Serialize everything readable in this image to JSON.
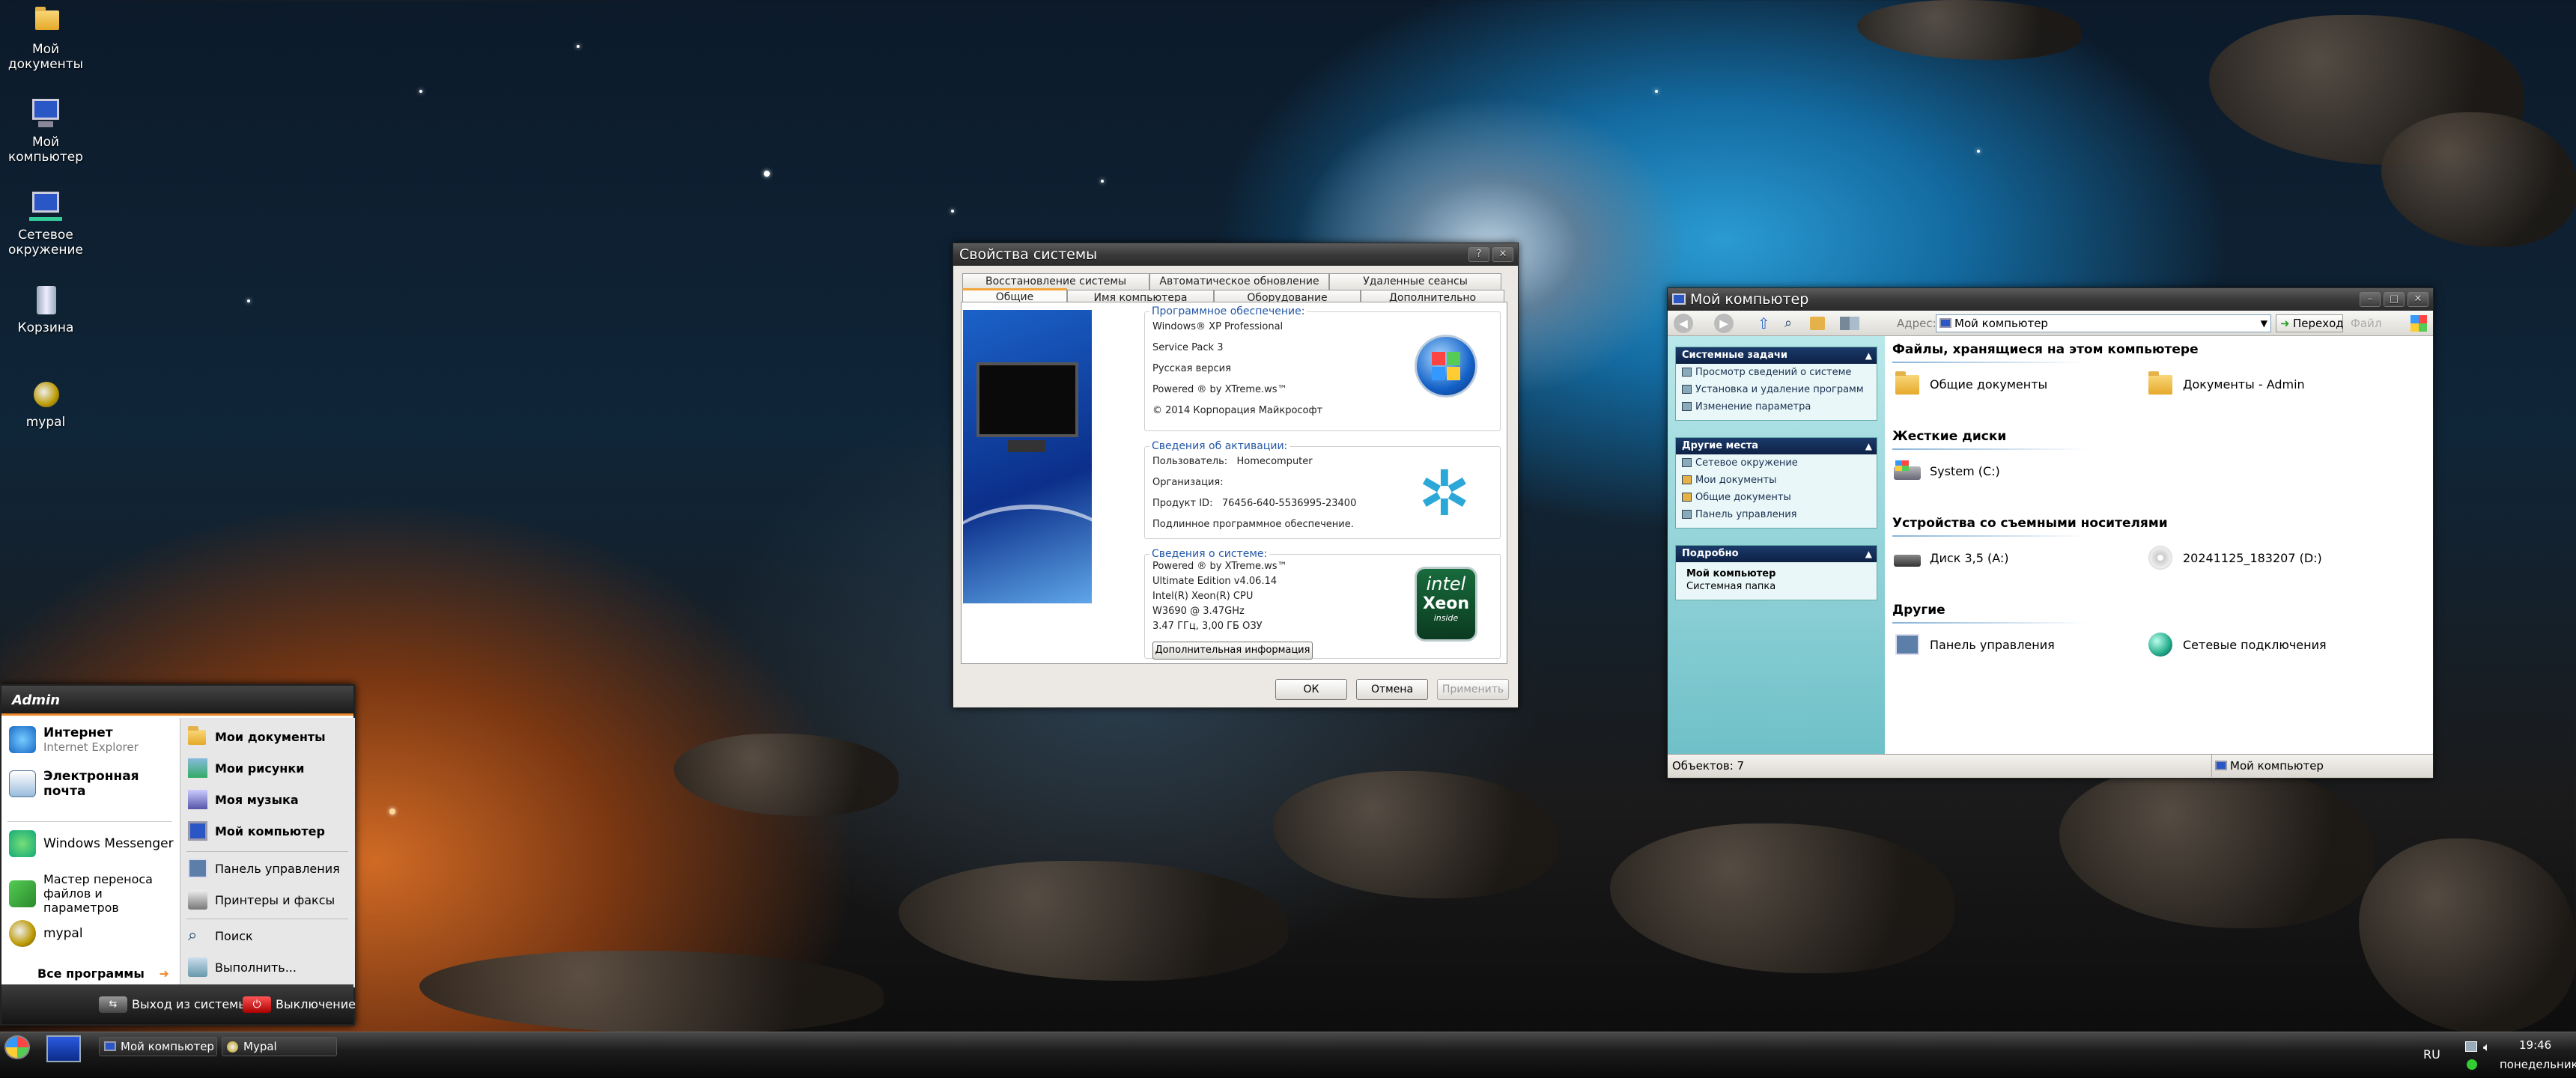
{
  "desktop": {
    "icons": [
      {
        "label": "Мой документы",
        "icon": "folder-documents-icon"
      },
      {
        "label": "Мой компьютер",
        "icon": "computer-icon"
      },
      {
        "label": "Сетевое окружение",
        "icon": "network-icon"
      },
      {
        "label": "Корзина",
        "icon": "recycle-bin-icon"
      },
      {
        "label": "mypal",
        "icon": "mypal-icon"
      }
    ]
  },
  "sysprops": {
    "title": "Свойства системы",
    "tabs_back": [
      "Восстановление системы",
      "Автоматическое обновление",
      "Удаленные сеансы"
    ],
    "tabs_front": [
      "Общие",
      "Имя компьютера",
      "Оборудование",
      "Дополнительно"
    ],
    "software": {
      "heading": "Программное обеспечение:",
      "lines": [
        "Windows® XP Professional",
        "Service Pack 3",
        "Русская версия",
        "Powered ® by XTreme.ws™",
        "© 2014 Корпорация Майкрософт"
      ]
    },
    "activation": {
      "heading": "Сведения об активации:",
      "user_label": "Пользователь:",
      "user_value": "Homecomputer",
      "org_label": "Организация:",
      "product_label": "Продукт ID:",
      "product_value": "76456-640-5536995-23400",
      "genuine": "Подлинное программное обеспечение."
    },
    "system": {
      "heading": "Сведения о системе:",
      "lines": [
        "Powered ® by XTreme.ws™",
        "Ultimate Edition v4.06.14",
        "Intel(R) Xeon(R) CPU",
        " W3690  @ 3.47GHz",
        "3.47 ГГц, 3,00 ГБ ОЗУ"
      ],
      "more_button": "Дополнительная информация",
      "logo_brand": "intel",
      "logo_product": "Xeon",
      "logo_sub": "inside"
    },
    "buttons": {
      "ok": "ОК",
      "cancel": "Отмена",
      "apply": "Применить"
    }
  },
  "explorer": {
    "title": "Мой компьютер",
    "address_label": "Адрес:",
    "address_value": "Мой компьютер",
    "go_label": "Переход",
    "file_label": "Файл",
    "panes": [
      {
        "title": "Системные задачи",
        "items": [
          "Просмотр сведений о системе",
          "Установка и удаление программ",
          "Изменение параметра"
        ]
      },
      {
        "title": "Другие места",
        "items": [
          "Сетевое окружение",
          "Мои документы",
          "Общие документы",
          "Панель управления"
        ]
      }
    ],
    "details": {
      "title": "Подробно",
      "name": "Мой компьютер",
      "desc": "Системная папка"
    },
    "sections": [
      {
        "title": "Файлы, хранящиеся на этом компьютере",
        "items": [
          "Общие документы",
          "Документы - Admin"
        ]
      },
      {
        "title": "Жесткие диски",
        "items": [
          "System (C:)"
        ]
      },
      {
        "title": "Устройства со съемными носителями",
        "items": [
          "Диск 3,5 (A:)",
          "20241125_183207 (D:)"
        ]
      },
      {
        "title": "Другие",
        "items": [
          "Панель управления",
          "Сетевые подключения"
        ]
      }
    ],
    "status_left": "Объектов: 7",
    "status_right": "Мой компьютер"
  },
  "startmenu": {
    "user": "Admin",
    "pinned": [
      {
        "title": "Интернет",
        "sub": "Internet Explorer"
      },
      {
        "title": "Электронная почта",
        "sub": ""
      }
    ],
    "recent": [
      "Windows Messenger",
      "Мастер переноса файлов и параметров",
      "mypal"
    ],
    "all_programs": "Все программы",
    "right_bold": [
      "Мои документы",
      "Мои рисунки",
      "Моя музыка",
      "Мой компьютер"
    ],
    "right_plain": [
      "Панель управления",
      "Принтеры и факсы",
      "Поиск",
      "Выполнить..."
    ],
    "logoff": "Выход из системы",
    "shutdown": "Выключение"
  },
  "taskbar": {
    "buttons": [
      "Мой компьютер",
      "Mypal"
    ],
    "lang": "RU",
    "time": "19:46",
    "day": "понедельник"
  },
  "colors": {
    "accent": "#f08a2c",
    "link": "#2357a6",
    "taskpane_head": "#0e2145"
  }
}
